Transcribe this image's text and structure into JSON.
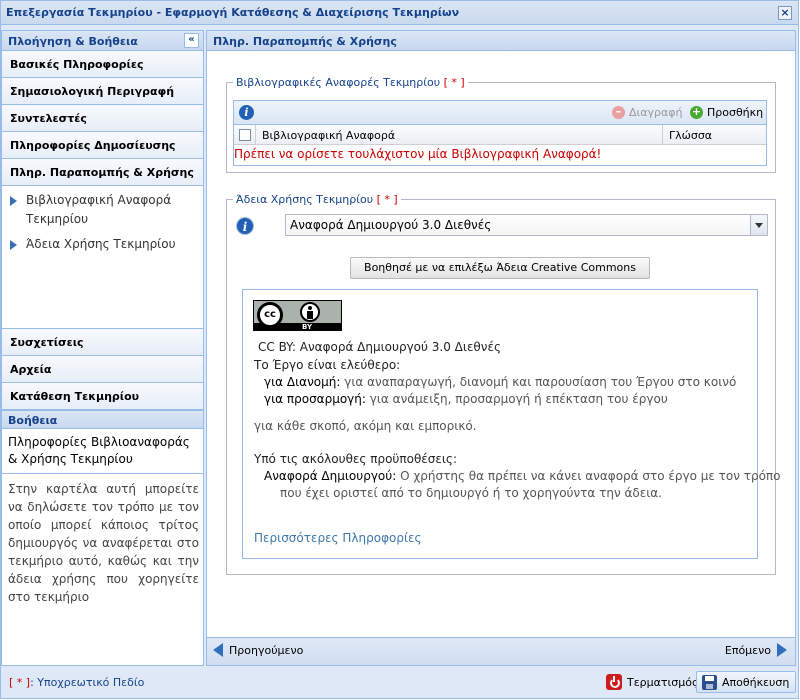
{
  "window": {
    "title": "Επεξεργασία Τεκμηρίου - Εφαρμογή Κατάθεσης & Διαχείρισης Τεκμηρίων",
    "close_label": "×"
  },
  "left_panel": {
    "title": "Πλοήγηση & Βοήθεια",
    "collapse_label": "«",
    "items_top": [
      {
        "label": "Βασικές Πληροφορίες"
      },
      {
        "label": "Σημασιολογική Περιγραφή"
      },
      {
        "label": "Συντελεστές"
      },
      {
        "label": "Πληροφορίες Δημοσίευσης"
      },
      {
        "label": "Πληρ. Παραπομπής & Χρήσης"
      }
    ],
    "sub_links": [
      {
        "label": "Βιβλιογραφική Αναφορά Τεκμηρίου"
      },
      {
        "label": "Άδεια Χρήσης Τεκμηρίου"
      }
    ],
    "items_bottom": [
      {
        "label": "Συσχετίσεις"
      },
      {
        "label": "Αρχεία"
      },
      {
        "label": "Κατάθεση Τεκμηρίου"
      }
    ],
    "help": {
      "title": "Βοήθεια",
      "heading": "Πληροφορίες Βιβλιοαναφοράς & Χρήσης Τεκμηρίου",
      "body": "Στην καρτέλα αυτή μπορείτε να δηλώσετε τον τρόπο με τον οποίο μπορεί κάποιος τρίτος δημιουργός να αναφέρεται στο τεκμήριο αυτό, καθώς και την άδεια χρήσης που χορηγείτε στο τεκμήριο"
    }
  },
  "main_panel": {
    "title": "Πληρ. Παραπομπής & Χρήσης",
    "citations": {
      "legend": "Βιβλιογραφικές Αναφορές Τεκμηρίου",
      "required_marker": "[ * ]",
      "delete_label": "Διαγραφή",
      "add_label": "Προσθήκη",
      "col_reference": "Βιβλιογραφική Αναφορά",
      "col_language": "Γλώσσα",
      "error": "Πρέπει να ορίσετε τουλάχιστον μία Βιβλιογραφική Αναφορά!"
    },
    "license": {
      "legend": "Άδεια Χρήσης Τεκμηρίου",
      "required_marker": "[ * ]",
      "selected_value": "Αναφορά Δημιουργού 3.0 Διεθνές",
      "helper_button": "Βοηθησέ με να επιλέξω Άδεια Creative Commons",
      "badge_cc": "cc",
      "badge_by": "BY",
      "summary_title": "CC BY: Αναφορά Δημιουργού 3.0 Διεθνές",
      "free_work": "Το Έργο είναι ελεύθερο:",
      "distribute_label": "για Διανομή:",
      "distribute_text": "για αναπαραγωγή, διανομή και παρουσίαση του Έργου στο κοινό",
      "adapt_label": "για προσαρμογή:",
      "adapt_text": "για ανάμειξη, προσαρμογή ή επέκταση του έργου",
      "any_purpose": "για κάθε σκοπό, ακόμη και εμπορικό.",
      "conditions": "Υπό τις ακόλουθες προϋποθέσεις:",
      "attribution_label": "Αναφορά Δημιουργού:",
      "attribution_text_1": "Ο χρήστης θα πρέπει να κάνει αναφορά στο έργο με τον τρόπο",
      "attribution_text_2": "που έχει οριστεί από το δημιουργό ή το χορηγούντα την άδεια.",
      "more_info": "Περισσότερες Πληροφορίες"
    },
    "nav": {
      "prev": "Προηγούμενο",
      "next": "Επόμενο"
    }
  },
  "footer": {
    "required_marker": "[ * ]",
    "required_note": ": Υποχρεωτικό Πεδίο",
    "cancel_label": "Τερματισμός",
    "save_label": "Αποθήκευση"
  }
}
